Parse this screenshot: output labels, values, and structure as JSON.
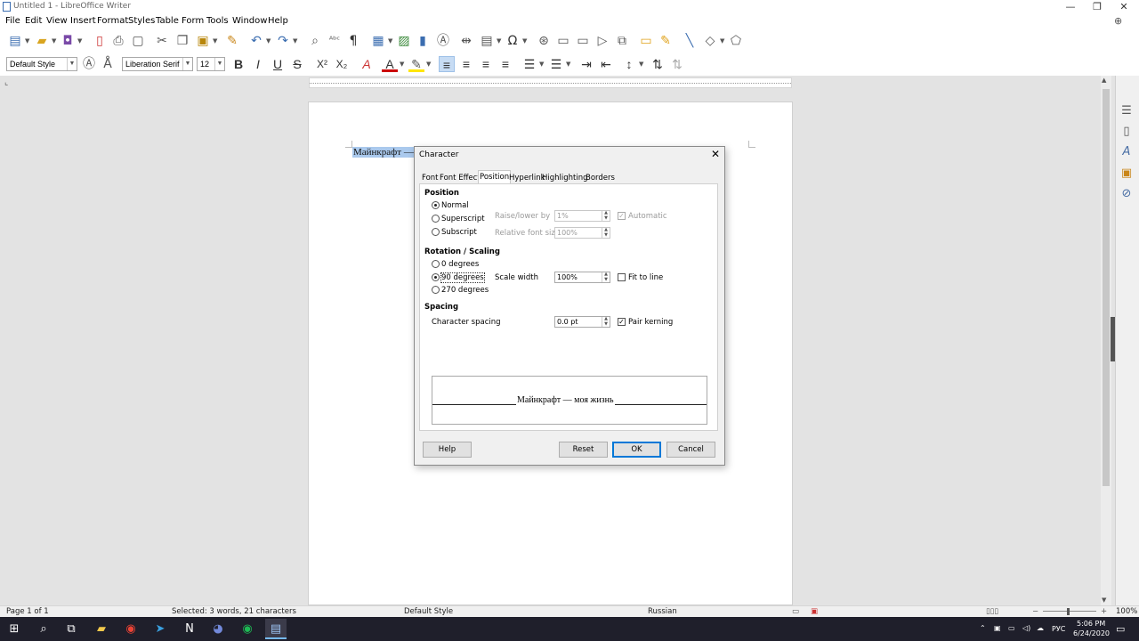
{
  "window": {
    "title": "Untitled 1 - LibreOffice Writer",
    "controls": {
      "minimize": "—",
      "restore": "❐",
      "close": "✕"
    }
  },
  "menu": [
    "File",
    "Edit",
    "View",
    "Insert",
    "Format",
    "Styles",
    "Table",
    "Form",
    "Tools",
    "Window",
    "Help"
  ],
  "toolbar": {
    "paragraph_style": "Default Style",
    "font_name": "Liberation Serif",
    "font_size": "12"
  },
  "document": {
    "selected_text": "Майнкрафт — моя жизнь"
  },
  "dialog": {
    "title": "Character",
    "close": "✕",
    "tabs": [
      "Font",
      "Font Effects",
      "Position",
      "Hyperlink",
      "Highlighting",
      "Borders"
    ],
    "active_tab": "Position",
    "position": {
      "heading": "Position",
      "normal": "Normal",
      "superscript": "Superscript",
      "subscript": "Subscript",
      "raise_label": "Raise/lower by",
      "raise_value": "1%",
      "automatic": "Automatic",
      "relsize_label": "Relative font size",
      "relsize_value": "100%",
      "selected": "Normal"
    },
    "rotation": {
      "heading": "Rotation / Scaling",
      "deg0": "0 degrees",
      "deg90": "90 degrees",
      "deg270": "270 degrees",
      "selected": "90 degrees",
      "scale_label": "Scale width",
      "scale_value": "100%",
      "fit_to_line": "Fit to line",
      "fit_checked": false
    },
    "spacing": {
      "heading": "Spacing",
      "char_spacing_label": "Character spacing",
      "char_spacing_value": "0.0 pt",
      "pair_kerning": "Pair kerning",
      "pair_kerning_checked": true
    },
    "preview_text": "Майнкрафт — моя жизнь",
    "buttons": {
      "help": "Help",
      "reset": "Reset",
      "ok": "OK",
      "cancel": "Cancel"
    }
  },
  "statusbar": {
    "page": "Page 1 of 1",
    "selection": "Selected: 3 words, 21 characters",
    "style": "Default Style",
    "language": "Russian",
    "zoom": "100%"
  },
  "taskbar": {
    "tray_lang": "РУС",
    "time": "5:06 PM",
    "date": "6/24/2020"
  },
  "colors": {
    "selection": "#aac9ed",
    "accent": "#0078d7"
  }
}
